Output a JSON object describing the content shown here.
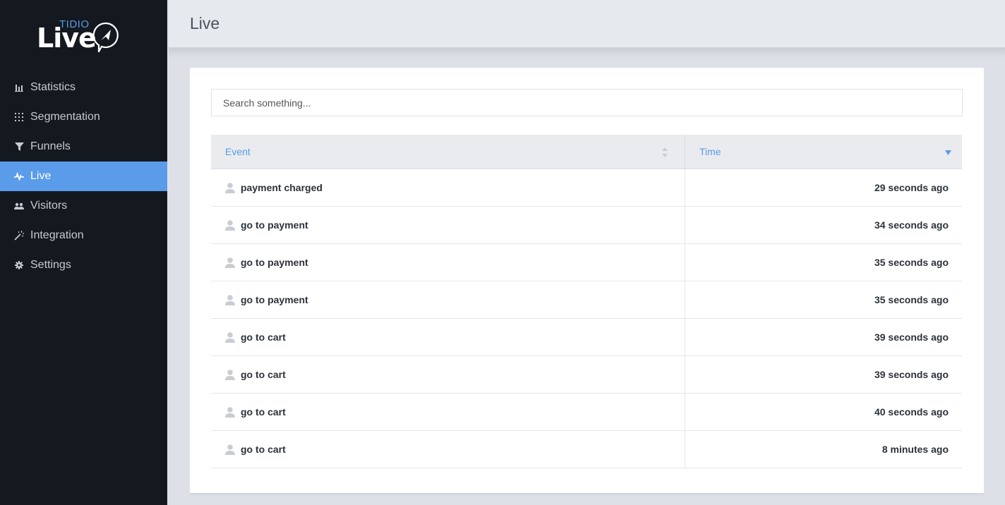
{
  "brand": {
    "word": "Live",
    "small": "TIDIO",
    "accent": "#5a9bea"
  },
  "sidebar": {
    "items": [
      {
        "label": "Statistics",
        "icon": "bar-chart-icon"
      },
      {
        "label": "Segmentation",
        "icon": "grid-icon"
      },
      {
        "label": "Funnels",
        "icon": "funnel-icon"
      },
      {
        "label": "Live",
        "icon": "pulse-icon",
        "active": true
      },
      {
        "label": "Visitors",
        "icon": "users-icon"
      },
      {
        "label": "Integration",
        "icon": "magic-wand-icon"
      },
      {
        "label": "Settings",
        "icon": "gear-icon"
      }
    ]
  },
  "header": {
    "title": "Live"
  },
  "search": {
    "placeholder": "Search something..."
  },
  "table": {
    "columns": [
      "Event",
      "Time"
    ],
    "rows": [
      {
        "event": "payment charged",
        "time": "29 seconds ago"
      },
      {
        "event": "go to payment",
        "time": "34 seconds ago"
      },
      {
        "event": "go to payment",
        "time": "35 seconds ago"
      },
      {
        "event": "go to payment",
        "time": "35 seconds ago"
      },
      {
        "event": "go to cart",
        "time": "39 seconds ago"
      },
      {
        "event": "go to cart",
        "time": "39 seconds ago"
      },
      {
        "event": "go to cart",
        "time": "40 seconds ago"
      },
      {
        "event": "go to cart",
        "time": "8 minutes ago"
      }
    ]
  }
}
